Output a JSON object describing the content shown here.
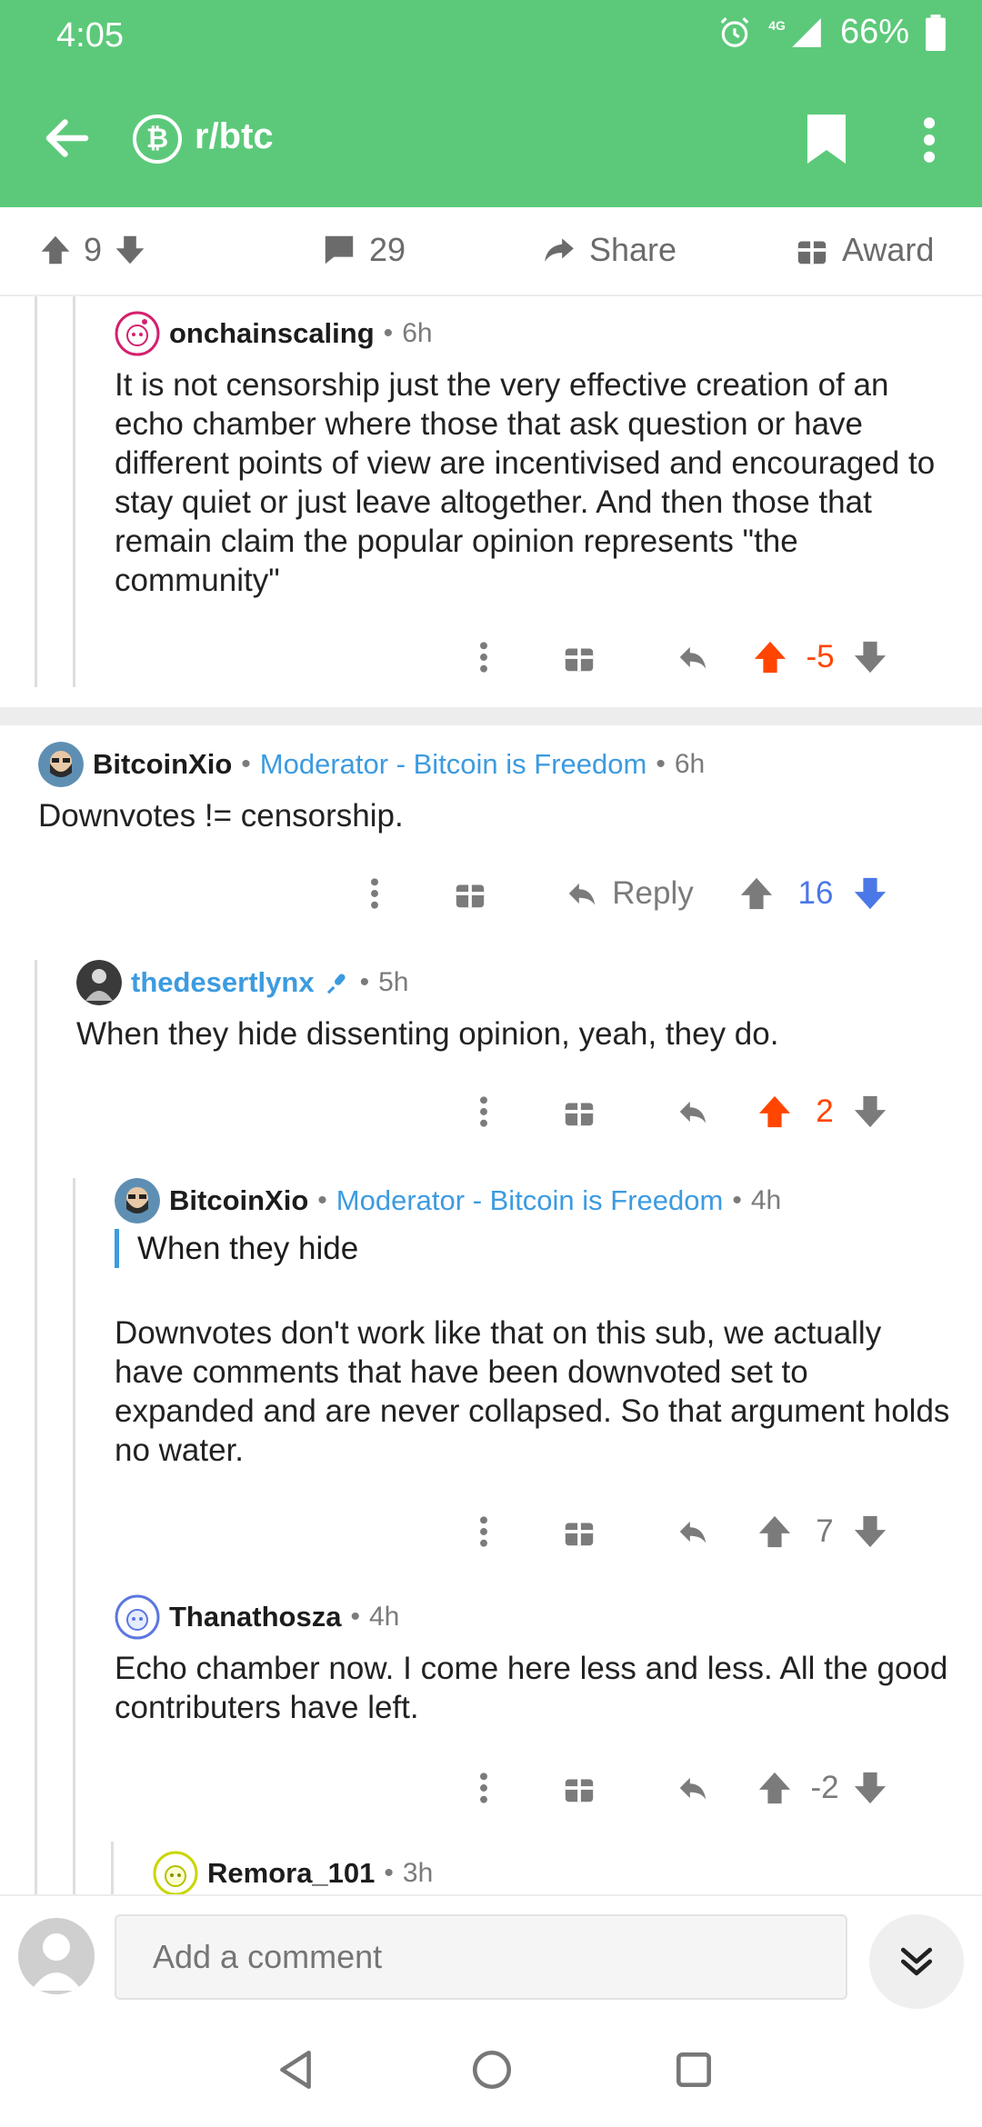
{
  "status": {
    "time": "4:05",
    "network": "4G",
    "battery": "66%"
  },
  "appbar": {
    "subreddit": "r/btc",
    "sub_icon_letter": "₿"
  },
  "actions": {
    "score": "9",
    "comments": "29",
    "share": "Share",
    "award": "Award"
  },
  "comments": [
    {
      "user": "onchainscaling",
      "time": "6h",
      "body": "It is not censorship just the very effective creation of an echo chamber where those that ask question or have different points of view are incentivised and encouraged to stay quiet or just leave altogether. And then those that remain claim the popular opinion represents \"the community\"",
      "score": "-5"
    },
    {
      "user": "BitcoinXio",
      "flair": "Moderator - Bitcoin is Freedom",
      "time": "6h",
      "body": "Downvotes != censorship.",
      "reply_label": "Reply",
      "score": "16"
    },
    {
      "user": "thedesertlynx",
      "time": "5h",
      "body": "When they hide dissenting opinion, yeah, they do.",
      "score": "2"
    },
    {
      "user": "BitcoinXio",
      "flair": "Moderator - Bitcoin is Freedom",
      "time": "4h",
      "quote": "When they hide",
      "body": "Downvotes don't work like that on this sub, we actually have comments that have been downvoted set to expanded and are never collapsed. So that argument holds no water.",
      "score": "7"
    },
    {
      "user": "Thanathosza",
      "time": "4h",
      "body": "Echo chamber now. I come here less and less. All the good contributers have left.",
      "score": "-2"
    },
    {
      "user": "Remora_101",
      "time": "3h"
    }
  ],
  "composer": {
    "placeholder": "Add a comment"
  },
  "colors": {
    "brand": "#5cc97a",
    "upvote": "#ff4500",
    "downvote": "#4b78e6",
    "mod": "#3c9be0"
  }
}
